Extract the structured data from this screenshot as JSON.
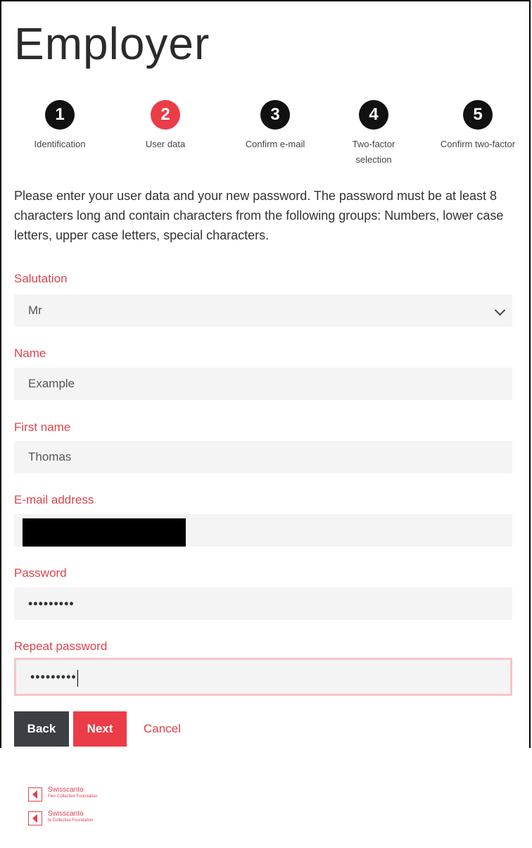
{
  "header": {
    "title": "Employer"
  },
  "steps": [
    {
      "number": "1",
      "label": "Identification",
      "active": false
    },
    {
      "number": "2",
      "label": "User data",
      "active": true
    },
    {
      "number": "3",
      "label": "Confirm e-mail",
      "active": false
    },
    {
      "number": "4",
      "label": "Two-factor selection",
      "active": false
    },
    {
      "number": "5",
      "label": "Confirm two-factor",
      "active": false
    }
  ],
  "intro": "Please enter your user data and your new password. The password must be at least 8 characters long and contain characters from the following groups: Numbers, lower case letters, upper case letters, special characters.",
  "form": {
    "salutation": {
      "label": "Salutation",
      "value": "Mr"
    },
    "name": {
      "label": "Name",
      "value": "Example"
    },
    "first_name": {
      "label": "First name",
      "value": "Thomas"
    },
    "email": {
      "label": "E-mail address",
      "value": ""
    },
    "password": {
      "label": "Password",
      "value": "•••••••••"
    },
    "repeat_password": {
      "label": "Repeat password",
      "value": "•••••••••"
    }
  },
  "actions": {
    "back": "Back",
    "next": "Next",
    "cancel": "Cancel"
  },
  "footer_logos": [
    {
      "name": "Swisscanto",
      "sub": "Flex Collective Foundation"
    },
    {
      "name": "Swisscanto",
      "sub": "te Collective Foundation"
    }
  ],
  "colors": {
    "accent": "#ea3d48",
    "label": "#e0424c",
    "step_inactive": "#111111",
    "button_dark": "#3c3f44",
    "field_bg": "#f4f4f4"
  }
}
